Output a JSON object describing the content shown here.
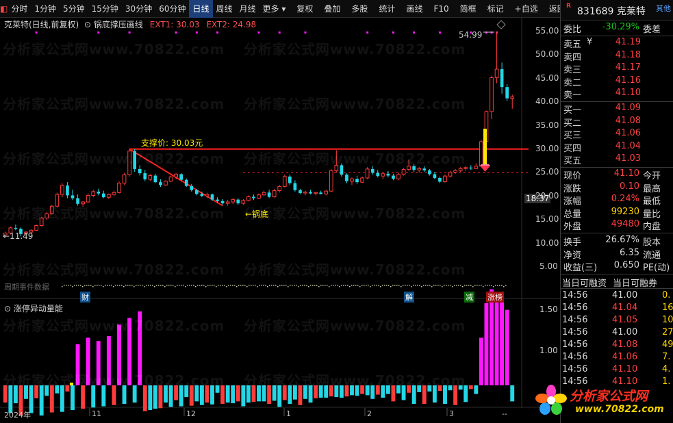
{
  "toolbar": {
    "mark": "◧",
    "items": [
      "分时",
      "1分钟",
      "5分钟",
      "15分钟",
      "30分钟",
      "60分钟",
      "日线",
      "周线",
      "月线",
      "更多 ▾"
    ],
    "active_index": 6,
    "right_items": [
      "复权",
      "叠加",
      "多股",
      "统计",
      "画线",
      "F10",
      "简框",
      "标记",
      "+自选",
      "返回"
    ]
  },
  "chart": {
    "title": "克莱特(日线,前复权)",
    "indicator_title": "锅底撑压画线",
    "ext1": "EXT1: 30.03",
    "ext2": "EXT2: 24.98",
    "support_label": "支撑价: 30.03元",
    "bottom_label": "←锅底",
    "low_label": "←11.49",
    "high_label": "54.99",
    "current_price_label": "18.37",
    "event_strip_label": "周期事件数据",
    "event_tags": [
      {
        "text": "财",
        "color": "#3aa0ff"
      },
      {
        "text": "解",
        "color": "#3aa0ff"
      },
      {
        "text": "减",
        "color": "#18c018"
      },
      {
        "text": "涨榜",
        "color": "#ff4040"
      }
    ],
    "volume_title": "涨停异动量能",
    "watermark": "分析家公式网www.70822.com"
  },
  "chart_data": [
    {
      "type": "candlestick",
      "title": "克莱特(日线,前复权)",
      "ylim": [
        2,
        58
      ],
      "y_ticks": [
        5.0,
        10.0,
        15.0,
        20.0,
        25.0,
        30.0,
        35.0,
        40.0,
        45.0,
        50.0,
        55.0
      ],
      "x_ticks": [
        "2024年",
        "11",
        "12",
        "1",
        "2",
        "3",
        "--"
      ],
      "support_line": 30.03,
      "dashed_line": 24.98,
      "candles": [
        [
          11.8,
          12.5,
          11.2,
          12.2
        ],
        [
          12.2,
          13.6,
          11.9,
          13.3
        ],
        [
          13.3,
          14.0,
          12.8,
          13.1
        ],
        [
          13.1,
          13.4,
          11.49,
          12.0
        ],
        [
          12.0,
          12.6,
          11.7,
          12.4
        ],
        [
          12.4,
          13.0,
          12.1,
          12.8
        ],
        [
          12.8,
          14.0,
          12.6,
          13.8
        ],
        [
          13.8,
          15.6,
          13.6,
          15.4
        ],
        [
          15.4,
          16.6,
          15.0,
          16.3
        ],
        [
          16.3,
          18.2,
          16.1,
          17.9
        ],
        [
          17.9,
          20.8,
          17.6,
          20.4
        ],
        [
          20.4,
          22.8,
          19.8,
          22.3
        ],
        [
          22.3,
          23.0,
          19.6,
          20.2
        ],
        [
          20.2,
          21.4,
          19.2,
          19.6
        ],
        [
          19.6,
          20.4,
          18.0,
          18.4
        ],
        [
          18.4,
          19.0,
          17.8,
          18.8
        ],
        [
          18.8,
          20.6,
          18.6,
          20.2
        ],
        [
          20.2,
          21.4,
          19.8,
          21.0
        ],
        [
          21.0,
          21.6,
          20.2,
          20.6
        ],
        [
          20.6,
          21.2,
          19.6,
          19.8
        ],
        [
          19.8,
          20.6,
          19.4,
          20.4
        ],
        [
          20.4,
          21.2,
          20.0,
          20.8
        ],
        [
          20.8,
          23.2,
          20.6,
          22.8
        ],
        [
          22.8,
          25.0,
          22.4,
          24.6
        ],
        [
          24.6,
          30.03,
          24.2,
          29.6
        ],
        [
          29.6,
          30.0,
          25.2,
          25.8
        ],
        [
          25.8,
          26.6,
          24.4,
          24.9
        ],
        [
          24.9,
          25.6,
          23.2,
          23.6
        ],
        [
          23.6,
          24.8,
          23.2,
          24.4
        ],
        [
          24.4,
          24.8,
          22.8,
          23.0
        ],
        [
          23.0,
          23.6,
          22.0,
          22.4
        ],
        [
          22.4,
          23.4,
          22.2,
          23.2
        ],
        [
          23.2,
          24.4,
          23.0,
          24.1
        ],
        [
          24.1,
          25.0,
          23.6,
          24.7
        ],
        [
          24.7,
          24.9,
          23.2,
          23.5
        ],
        [
          23.5,
          23.8,
          22.0,
          22.2
        ],
        [
          22.2,
          22.6,
          21.0,
          21.3
        ],
        [
          21.3,
          21.6,
          20.2,
          20.5
        ],
        [
          20.5,
          21.0,
          19.8,
          20.1
        ],
        [
          20.1,
          20.8,
          19.6,
          20.4
        ],
        [
          20.4,
          20.6,
          19.0,
          19.3
        ],
        [
          19.3,
          19.8,
          18.6,
          19.0
        ],
        [
          19.0,
          19.4,
          18.2,
          18.5
        ],
        [
          18.5,
          19.2,
          18.0,
          18.8
        ],
        [
          18.8,
          19.6,
          18.4,
          19.3
        ],
        [
          19.3,
          19.6,
          18.2,
          18.5
        ],
        [
          18.5,
          19.4,
          18.2,
          19.1
        ],
        [
          19.1,
          20.2,
          18.9,
          19.9
        ],
        [
          19.9,
          20.4,
          19.2,
          19.6
        ],
        [
          19.6,
          20.6,
          19.4,
          20.3
        ],
        [
          20.3,
          21.2,
          20.0,
          20.8
        ],
        [
          20.8,
          21.4,
          19.6,
          19.9
        ],
        [
          19.9,
          21.6,
          19.7,
          21.2
        ],
        [
          21.2,
          22.4,
          20.8,
          22.1
        ],
        [
          22.1,
          24.6,
          21.9,
          24.2
        ],
        [
          24.2,
          24.6,
          22.4,
          22.8
        ],
        [
          22.8,
          23.4,
          21.0,
          21.3
        ],
        [
          21.3,
          21.6,
          20.4,
          20.7
        ],
        [
          20.7,
          21.2,
          20.2,
          20.9
        ],
        [
          20.9,
          21.4,
          20.4,
          20.6
        ],
        [
          20.6,
          21.0,
          20.2,
          20.8
        ],
        [
          20.8,
          21.2,
          20.4,
          20.5
        ],
        [
          20.5,
          21.4,
          20.2,
          21.1
        ],
        [
          21.1,
          25.8,
          20.9,
          25.4
        ],
        [
          25.4,
          29.8,
          25.0,
          26.6
        ],
        [
          26.6,
          27.0,
          24.2,
          24.6
        ],
        [
          24.6,
          24.9,
          22.8,
          23.2
        ],
        [
          23.2,
          24.0,
          22.4,
          23.7
        ],
        [
          23.7,
          24.4,
          22.6,
          23.0
        ],
        [
          23.0,
          24.2,
          22.8,
          23.9
        ],
        [
          23.9,
          26.2,
          23.6,
          25.8
        ],
        [
          25.8,
          26.4,
          24.6,
          25.0
        ],
        [
          25.0,
          25.6,
          24.0,
          24.3
        ],
        [
          24.3,
          25.0,
          23.6,
          24.8
        ],
        [
          24.8,
          25.4,
          24.0,
          24.4
        ],
        [
          24.4,
          24.8,
          23.4,
          23.7
        ],
        [
          23.7,
          25.0,
          23.4,
          24.6
        ],
        [
          24.6,
          26.0,
          24.4,
          25.7
        ],
        [
          25.7,
          27.8,
          25.4,
          26.4
        ],
        [
          26.4,
          26.8,
          25.2,
          25.6
        ],
        [
          25.6,
          26.2,
          25.0,
          25.9
        ],
        [
          25.9,
          26.4,
          25.2,
          25.5
        ],
        [
          25.5,
          25.8,
          24.4,
          24.7
        ],
        [
          24.7,
          25.2,
          23.6,
          23.9
        ],
        [
          23.9,
          24.2,
          22.8,
          23.1
        ],
        [
          23.1,
          24.6,
          22.9,
          24.3
        ],
        [
          24.3,
          25.4,
          24.0,
          25.1
        ],
        [
          25.1,
          25.8,
          24.8,
          25.5
        ],
        [
          25.5,
          26.2,
          25.2,
          25.9
        ],
        [
          25.9,
          26.4,
          25.4,
          26.1
        ],
        [
          26.1,
          26.6,
          25.6,
          25.9
        ],
        [
          25.9,
          27.0,
          25.8,
          26.4
        ],
        [
          26.4,
          32.0,
          26.2,
          31.6
        ],
        [
          31.6,
          38.2,
          31.4,
          38.0
        ],
        [
          38.0,
          45.6,
          36.4,
          45.2
        ],
        [
          45.2,
          54.99,
          44.0,
          47.0
        ],
        [
          47.0,
          48.4,
          41.8,
          43.2
        ],
        [
          43.2,
          43.8,
          40.2,
          40.8
        ],
        [
          40.8,
          41.6,
          38.6,
          41.1
        ]
      ]
    },
    {
      "type": "bar",
      "title": "涨停异动量能",
      "y_ticks": [
        1.0,
        1.5
      ],
      "values": [
        0.72,
        0.55,
        0.71,
        0.52,
        0.78,
        0.55,
        0.79,
        0.51,
        0.83,
        0.56,
        0.87,
        0.57,
        0.9,
        0.6,
        1.08,
        0.62,
        1.16,
        0.64,
        1.12,
        0.66,
        1.18,
        0.68,
        1.32,
        0.7,
        1.4,
        0.72,
        1.48,
        0.58,
        0.6,
        0.62,
        0.63,
        0.72,
        0.65,
        0.76,
        0.66,
        0.81,
        0.67,
        0.74,
        0.68,
        0.72,
        0.69,
        0.88,
        0.7,
        0.72,
        0.71,
        0.74,
        0.66,
        0.72,
        0.73,
        0.74,
        0.74,
        0.7,
        0.75,
        0.65,
        0.76,
        0.7,
        0.77,
        0.68,
        0.78,
        0.72,
        0.79,
        0.8,
        0.8,
        0.82,
        0.81,
        0.8,
        0.82,
        0.84,
        0.83,
        0.86,
        0.84,
        0.78,
        0.85,
        0.8,
        0.86,
        0.74,
        0.87,
        0.76,
        0.88,
        0.7,
        0.89,
        0.7,
        0.9,
        0.72,
        0.91,
        0.7,
        0.92,
        0.68,
        0.93,
        0.73,
        0.94,
        0.86,
        1.16,
        1.58,
        1.75,
        1.72,
        1.62,
        1.5,
        0.74
      ]
    }
  ],
  "panel": {
    "flag": "R",
    "code_name": "831689 克莱特",
    "other": "其他",
    "weibi_label": "委比",
    "weibi_value": "-30.29%",
    "weicha_label": "委差",
    "asks": [
      {
        "label": "卖五",
        "price": "41.19",
        "mark": "¥"
      },
      {
        "label": "卖四",
        "price": "41.18"
      },
      {
        "label": "卖三",
        "price": "41.17"
      },
      {
        "label": "卖二",
        "price": "41.16"
      },
      {
        "label": "卖一",
        "price": "41.10"
      }
    ],
    "bids": [
      {
        "label": "买一",
        "price": "41.09"
      },
      {
        "label": "买二",
        "price": "41.08"
      },
      {
        "label": "买三",
        "price": "41.06"
      },
      {
        "label": "买四",
        "price": "41.04"
      },
      {
        "label": "买五",
        "price": "41.03"
      }
    ],
    "stats": [
      {
        "label": "现价",
        "value": "41.10",
        "right": "今开",
        "color": "red"
      },
      {
        "label": "涨跌",
        "value": "0.10",
        "right": "最高",
        "color": "red"
      },
      {
        "label": "涨幅",
        "value": "0.24%",
        "right": "最低",
        "color": "red"
      },
      {
        "label": "总量",
        "value": "99230",
        "right": "量比",
        "color": "yellow"
      },
      {
        "label": "外盘",
        "value": "49480",
        "right": "内盘",
        "color": "red"
      }
    ],
    "stats2": [
      {
        "label": "换手",
        "value": "26.67%",
        "right": "股本"
      },
      {
        "label": "净资",
        "value": "6.35",
        "right": "流通"
      },
      {
        "label": "收益(三)",
        "value": "0.650",
        "right": "PE(动)"
      }
    ],
    "margin_left": "当日可融资",
    "margin_right": "当日可融券",
    "ticks": [
      {
        "time": "14:56",
        "price": "41.00",
        "vol": "0.",
        "color": "white"
      },
      {
        "time": "14:56",
        "price": "41.04",
        "vol": "16.",
        "color": "red"
      },
      {
        "time": "14:56",
        "price": "41.05",
        "vol": "10.",
        "color": "red"
      },
      {
        "time": "14:56",
        "price": "41.00",
        "vol": "27.",
        "color": "white"
      },
      {
        "time": "14:56",
        "price": "41.08",
        "vol": "49.",
        "color": "red"
      },
      {
        "time": "14:56",
        "price": "41.06",
        "vol": "7.",
        "color": "red"
      },
      {
        "time": "14:56",
        "price": "41.10",
        "vol": "4.",
        "color": "red"
      },
      {
        "time": "14:56",
        "price": "41.10",
        "vol": "1.",
        "color": "red"
      }
    ]
  },
  "logo": {
    "line1": "分析家公式网",
    "line2": "www.70822.com"
  },
  "colors": {
    "up": "#ff3b3b",
    "down": "#23d7e6",
    "magenta": "#ff18ff",
    "support": "#ff2020",
    "yellow": "#ffe800"
  }
}
